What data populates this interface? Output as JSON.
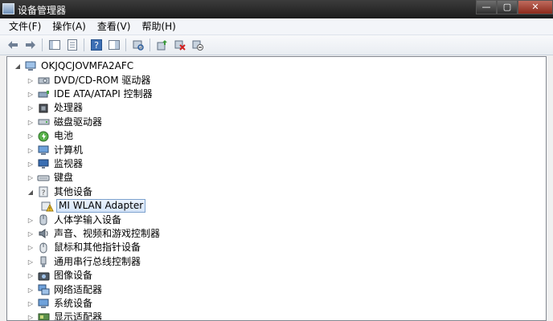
{
  "window": {
    "title": "设备管理器",
    "controls": {
      "minimize": "—",
      "maximize": "▢",
      "close": "✕"
    }
  },
  "menu": [
    {
      "label": "文件(F)"
    },
    {
      "label": "操作(A)"
    },
    {
      "label": "查看(V)"
    },
    {
      "label": "帮助(H)"
    }
  ],
  "toolbar": [
    {
      "icon": "back-arrow-icon"
    },
    {
      "icon": "forward-arrow-icon"
    },
    {
      "icon": "properties-icon"
    },
    {
      "icon": "show-hide-console-tree-icon"
    },
    {
      "icon": "help-icon"
    },
    {
      "icon": "console-icon"
    },
    {
      "icon": "scan-hardware-icon"
    },
    {
      "icon": "update-driver-icon"
    },
    {
      "icon": "uninstall-icon"
    },
    {
      "icon": "disable-device-icon"
    }
  ],
  "tree": {
    "root": "OKJQCJOVMFA2AFC",
    "categories": [
      {
        "label": "DVD/CD-ROM 驱动器",
        "icon": "optical-drive-icon"
      },
      {
        "label": "IDE ATA/ATAPI 控制器",
        "icon": "ide-controller-icon"
      },
      {
        "label": "处理器",
        "icon": "processor-icon"
      },
      {
        "label": "磁盘驱动器",
        "icon": "disk-drive-icon"
      },
      {
        "label": "电池",
        "icon": "battery-icon"
      },
      {
        "label": "计算机",
        "icon": "computer-icon"
      },
      {
        "label": "监视器",
        "icon": "monitor-icon"
      },
      {
        "label": "键盘",
        "icon": "keyboard-icon"
      },
      {
        "label": "其他设备",
        "icon": "unknown-device-icon",
        "expanded": true
      },
      {
        "label": "MI WLAN Adapter",
        "icon": "warning-device-icon",
        "child": true,
        "selected": true
      },
      {
        "label": "人体学输入设备",
        "icon": "hid-icon"
      },
      {
        "label": "声音、视频和游戏控制器",
        "icon": "sound-icon"
      },
      {
        "label": "鼠标和其他指针设备",
        "icon": "mouse-icon"
      },
      {
        "label": "通用串行总线控制器",
        "icon": "usb-icon"
      },
      {
        "label": "图像设备",
        "icon": "camera-icon"
      },
      {
        "label": "网络适配器",
        "icon": "network-adapter-icon"
      },
      {
        "label": "系统设备",
        "icon": "system-device-icon"
      },
      {
        "label": "显示适配器",
        "icon": "display-adapter-icon"
      }
    ]
  }
}
